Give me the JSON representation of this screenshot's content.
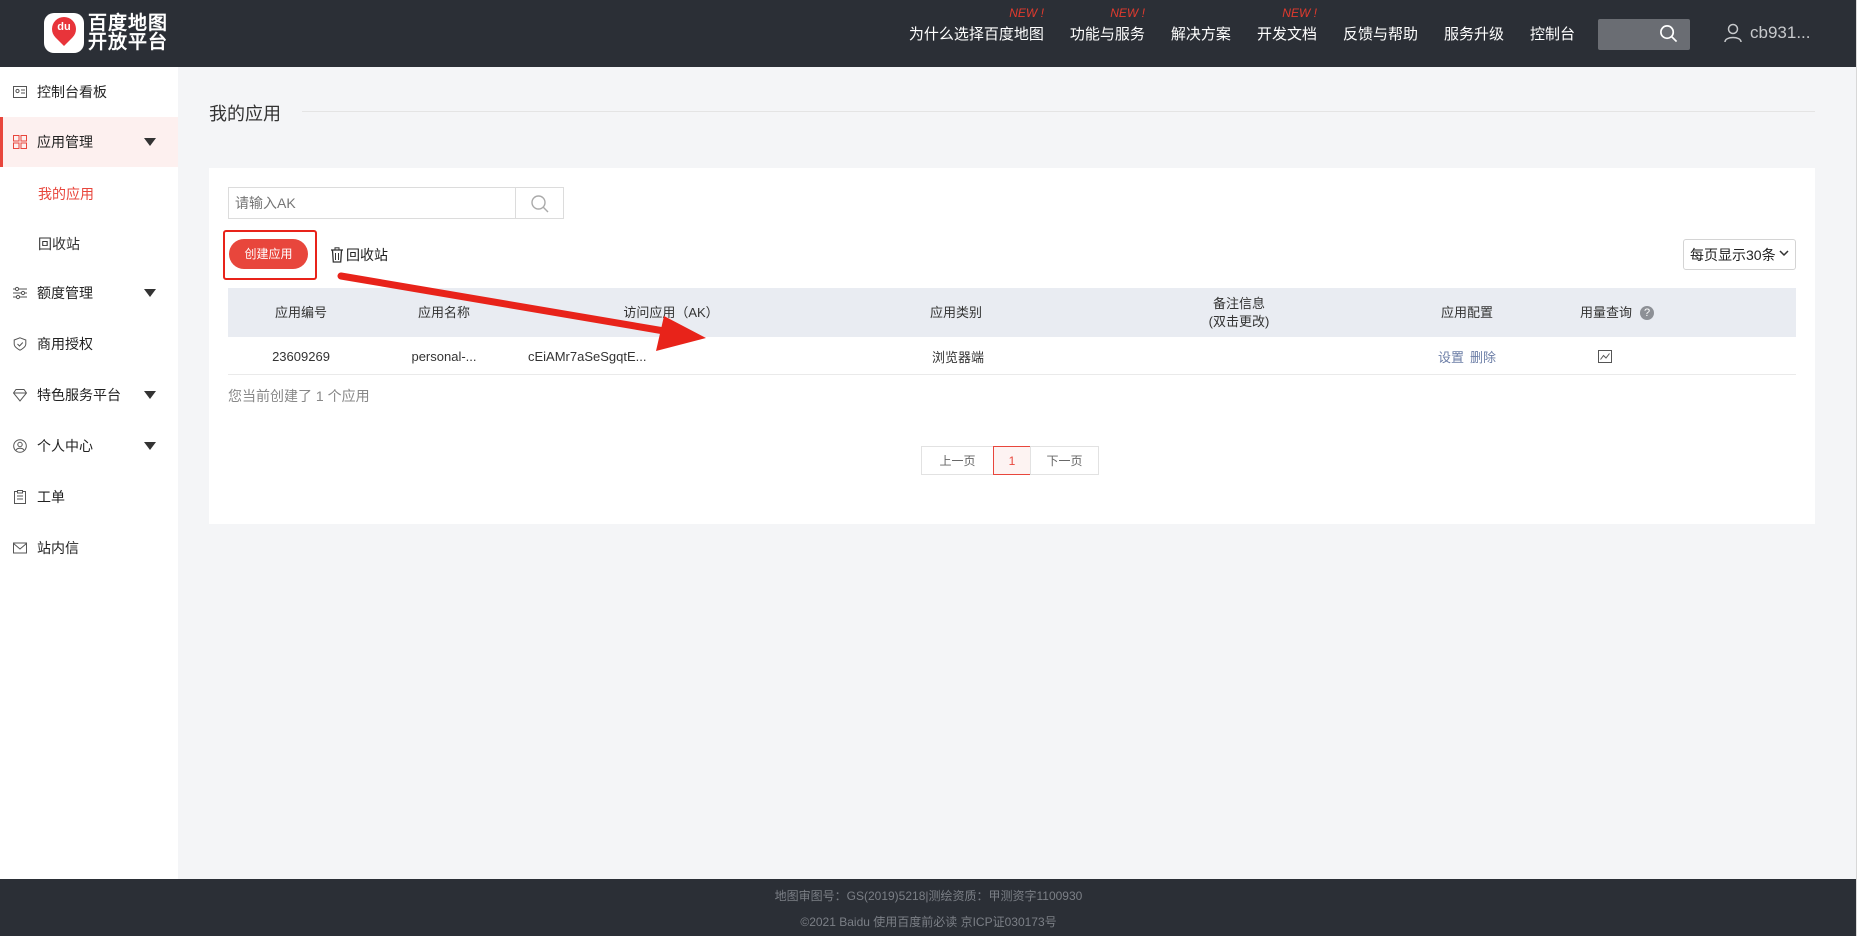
{
  "brand": {
    "logo_line1": "百度地图",
    "logo_line2": "开放平台",
    "logo_badge": "du"
  },
  "nav": {
    "items": [
      {
        "label": "为什么选择百度地图",
        "badge": "NEW !"
      },
      {
        "label": "功能与服务",
        "badge": "NEW !"
      },
      {
        "label": "解决方案",
        "badge": ""
      },
      {
        "label": "开发文档",
        "badge": "NEW !"
      },
      {
        "label": "反馈与帮助",
        "badge": ""
      },
      {
        "label": "服务升级",
        "badge": ""
      },
      {
        "label": "控制台",
        "badge": ""
      }
    ],
    "user": "cb931..."
  },
  "sidebar": {
    "items": [
      {
        "label": "控制台看板",
        "icon": "dashboard-icon"
      },
      {
        "label": "应用管理",
        "icon": "grid-icon",
        "expanded": true
      },
      {
        "label": "额度管理",
        "icon": "sliders-icon"
      },
      {
        "label": "商用授权",
        "icon": "shield-icon"
      },
      {
        "label": "特色服务平台",
        "icon": "diamond-icon"
      },
      {
        "label": "个人中心",
        "icon": "user-circle-icon"
      },
      {
        "label": "工单",
        "icon": "clipboard-icon"
      },
      {
        "label": "站内信",
        "icon": "mail-icon"
      }
    ],
    "subitems": [
      {
        "label": "我的应用",
        "current": true
      },
      {
        "label": "回收站",
        "current": false
      }
    ]
  },
  "main": {
    "title": "我的应用",
    "search": {
      "placeholder": "请输入AK"
    },
    "create_label": "创建应用",
    "recycle_label": "回收站",
    "per_page": "每页显示30条",
    "table": {
      "headers": {
        "id": "应用编号",
        "name": "应用名称",
        "ak": "访问应用（AK）",
        "type": "应用类别",
        "note_line1": "备注信息",
        "note_line2": "(双击更改)",
        "config": "应用配置",
        "usage": "用量查询",
        "help": "?"
      },
      "rows": [
        {
          "id": "23609269",
          "name": "personal-...",
          "ak": "cEiAMr7aSeSgqtE...",
          "type": "浏览器端",
          "note": "",
          "settings": "设置",
          "delete": "删除"
        }
      ]
    },
    "summary": "您当前创建了 1 个应用",
    "pager": {
      "prev": "上一页",
      "page": "1",
      "next": "下一页"
    }
  },
  "footer": {
    "line1": "地图审图号：GS(2019)5218|测绘资质：甲测资字1100930",
    "line2": "©2021 Baidu 使用百度前必读 京ICP证030173号"
  },
  "colors": {
    "accent": "#e8463c",
    "annotation": "#e8231a",
    "topbar": "#2b2f36"
  }
}
